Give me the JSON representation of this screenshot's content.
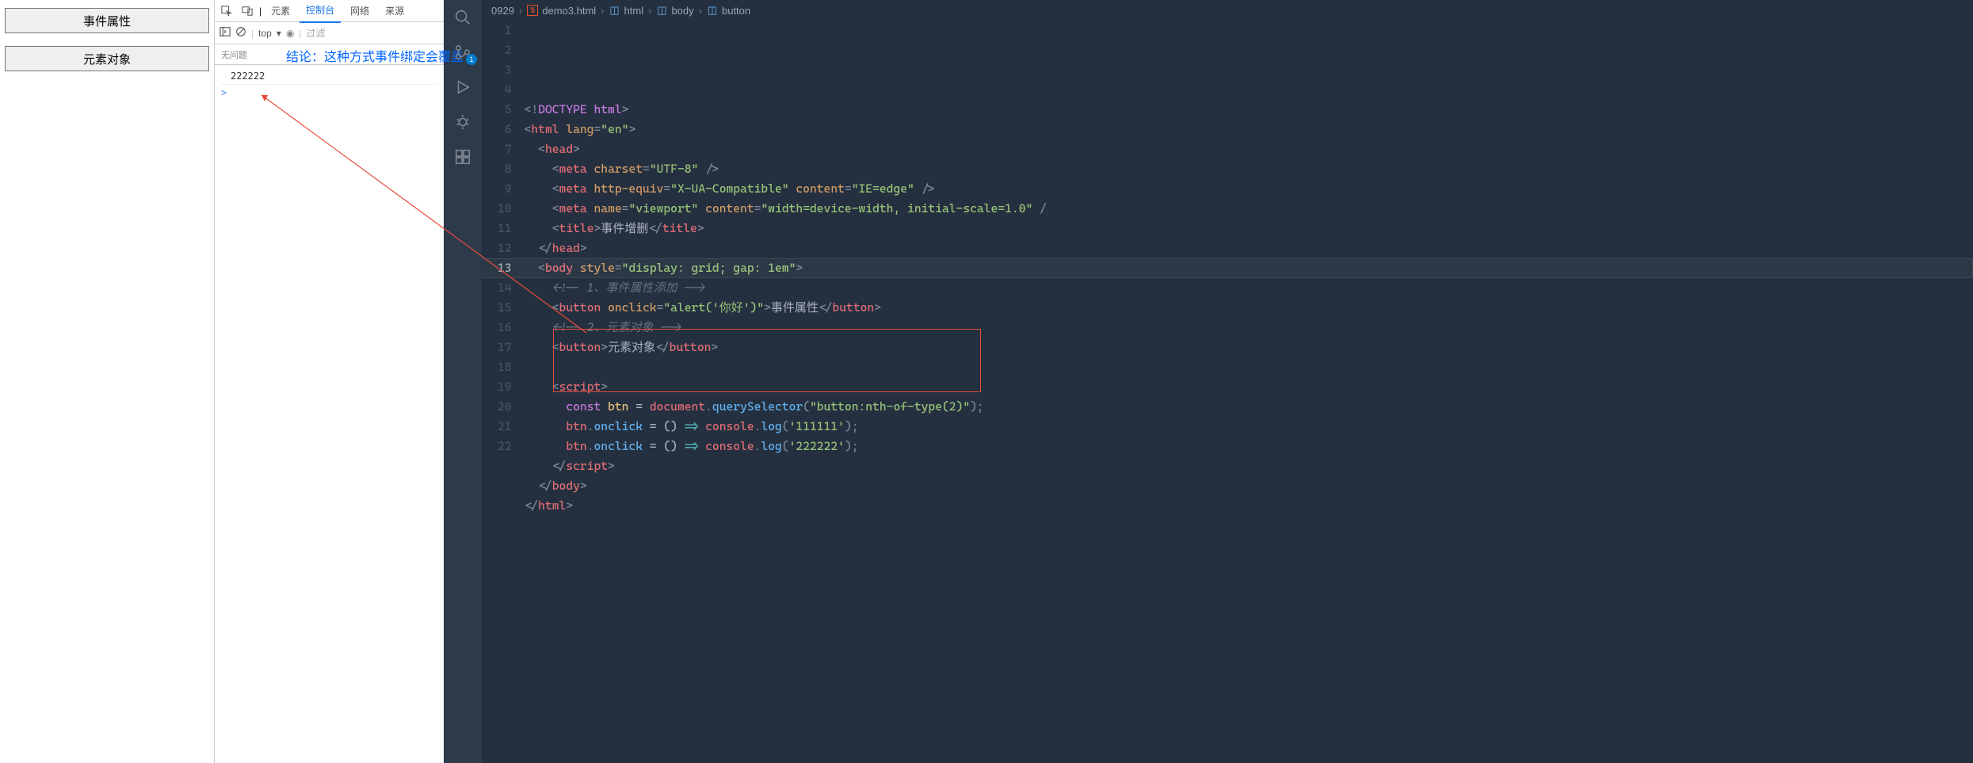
{
  "browser": {
    "buttons": [
      "事件属性",
      "元素对象"
    ]
  },
  "devtools": {
    "tabs": [
      "元素",
      "控制台",
      "网络",
      "来源"
    ],
    "active_tab_index": 1,
    "toolbar": {
      "top": "top",
      "filter": "过滤"
    },
    "filter_label": "无问题",
    "console_output": "222222",
    "prompt": ">"
  },
  "annotation": {
    "text": "结论：这种方式事件绑定会覆盖"
  },
  "vscode": {
    "badge_count": "1",
    "breadcrumb": {
      "items": [
        "0929",
        "demo3.html",
        "html",
        "body",
        "button"
      ]
    },
    "code": {
      "lines": [
        {
          "n": 1,
          "tokens": [
            [
              "<!",
              "punc"
            ],
            [
              "DOCTYPE html",
              "doctype"
            ],
            [
              ">",
              "punc"
            ]
          ]
        },
        {
          "n": 2,
          "tokens": [
            [
              "<",
              "punc"
            ],
            [
              "html",
              "tag"
            ],
            [
              " ",
              "text"
            ],
            [
              "lang",
              "attr"
            ],
            [
              "=",
              "punc"
            ],
            [
              "\"en\"",
              "str"
            ],
            [
              ">",
              "punc"
            ]
          ]
        },
        {
          "n": 3,
          "tokens": [
            [
              "  <",
              "punc"
            ],
            [
              "head",
              "tag"
            ],
            [
              ">",
              "punc"
            ]
          ]
        },
        {
          "n": 4,
          "tokens": [
            [
              "    <",
              "punc"
            ],
            [
              "meta",
              "tag"
            ],
            [
              " ",
              "text"
            ],
            [
              "charset",
              "attr"
            ],
            [
              "=",
              "punc"
            ],
            [
              "\"UTF-8\"",
              "str"
            ],
            [
              " />",
              "punc"
            ]
          ]
        },
        {
          "n": 5,
          "tokens": [
            [
              "    <",
              "punc"
            ],
            [
              "meta",
              "tag"
            ],
            [
              " ",
              "text"
            ],
            [
              "http-equiv",
              "attr"
            ],
            [
              "=",
              "punc"
            ],
            [
              "\"X-UA-Compatible\"",
              "str"
            ],
            [
              " ",
              "text"
            ],
            [
              "content",
              "attr"
            ],
            [
              "=",
              "punc"
            ],
            [
              "\"IE=edge\"",
              "str"
            ],
            [
              " />",
              "punc"
            ]
          ]
        },
        {
          "n": 6,
          "tokens": [
            [
              "    <",
              "punc"
            ],
            [
              "meta",
              "tag"
            ],
            [
              " ",
              "text"
            ],
            [
              "name",
              "attr"
            ],
            [
              "=",
              "punc"
            ],
            [
              "\"viewport\"",
              "str"
            ],
            [
              " ",
              "text"
            ],
            [
              "content",
              "attr"
            ],
            [
              "=",
              "punc"
            ],
            [
              "\"width=device-width, initial-scale=1.0\"",
              "str"
            ],
            [
              " /",
              "punc"
            ]
          ]
        },
        {
          "n": 7,
          "tokens": [
            [
              "    <",
              "punc"
            ],
            [
              "title",
              "tag"
            ],
            [
              ">",
              "punc"
            ],
            [
              "事件增删",
              "text"
            ],
            [
              "</",
              "punc"
            ],
            [
              "title",
              "tag"
            ],
            [
              ">",
              "punc"
            ]
          ]
        },
        {
          "n": 8,
          "tokens": [
            [
              "  </",
              "punc"
            ],
            [
              "head",
              "tag"
            ],
            [
              ">",
              "punc"
            ]
          ]
        },
        {
          "n": 9,
          "tokens": [
            [
              "  <",
              "punc"
            ],
            [
              "body",
              "tag"
            ],
            [
              " ",
              "text"
            ],
            [
              "style",
              "attr"
            ],
            [
              "=",
              "punc"
            ],
            [
              "\"display: grid; gap: 1em\"",
              "str"
            ],
            [
              ">",
              "punc"
            ]
          ]
        },
        {
          "n": 10,
          "tokens": [
            [
              "    ",
              "text"
            ],
            [
              "<!-- 1、事件属性添加 -->",
              "cm-cn"
            ]
          ]
        },
        {
          "n": 11,
          "tokens": [
            [
              "    <",
              "punc"
            ],
            [
              "button",
              "tag"
            ],
            [
              " ",
              "text"
            ],
            [
              "onclick",
              "attr"
            ],
            [
              "=",
              "punc"
            ],
            [
              "\"alert('你好')\"",
              "str"
            ],
            [
              ">",
              "punc"
            ],
            [
              "事件属性",
              "text"
            ],
            [
              "</",
              "punc"
            ],
            [
              "button",
              "tag"
            ],
            [
              ">",
              "punc"
            ]
          ]
        },
        {
          "n": 12,
          "tokens": [
            [
              "    ",
              "text"
            ],
            [
              "<!-- 2、元素对象 -->",
              "cm-cn"
            ]
          ]
        },
        {
          "n": 13,
          "tokens": [
            [
              "    <",
              "punc"
            ],
            [
              "button",
              "tag"
            ],
            [
              ">",
              "punc"
            ],
            [
              "元素对象",
              "text"
            ],
            [
              "</",
              "punc"
            ],
            [
              "button",
              "tag"
            ],
            [
              ">",
              "punc"
            ]
          ],
          "active": true
        },
        {
          "n": 14,
          "tokens": []
        },
        {
          "n": 15,
          "tokens": [
            [
              "    <",
              "punc"
            ],
            [
              "script",
              "tag"
            ],
            [
              ">",
              "punc"
            ]
          ]
        },
        {
          "n": 16,
          "tokens": [
            [
              "      ",
              "text"
            ],
            [
              "const",
              "kw"
            ],
            [
              " ",
              "text"
            ],
            [
              "btn",
              "const"
            ],
            [
              " = ",
              "text"
            ],
            [
              "document",
              "var"
            ],
            [
              ".",
              "punc"
            ],
            [
              "querySelector",
              "fn"
            ],
            [
              "(",
              "punc"
            ],
            [
              "\"button:nth-of-type(2)\"",
              "str"
            ],
            [
              ");",
              "punc"
            ]
          ]
        },
        {
          "n": 17,
          "tokens": [
            [
              "      ",
              "text"
            ],
            [
              "btn",
              "var"
            ],
            [
              ".",
              "punc"
            ],
            [
              "onclick",
              "fn"
            ],
            [
              " = () ",
              "text"
            ],
            [
              "=>",
              "op"
            ],
            [
              " ",
              "text"
            ],
            [
              "console",
              "var"
            ],
            [
              ".",
              "punc"
            ],
            [
              "log",
              "fn"
            ],
            [
              "(",
              "punc"
            ],
            [
              "'111111'",
              "str"
            ],
            [
              ");",
              "punc"
            ]
          ]
        },
        {
          "n": 18,
          "tokens": [
            [
              "      ",
              "text"
            ],
            [
              "btn",
              "var"
            ],
            [
              ".",
              "punc"
            ],
            [
              "onclick",
              "fn"
            ],
            [
              " = () ",
              "text"
            ],
            [
              "=>",
              "op"
            ],
            [
              " ",
              "text"
            ],
            [
              "console",
              "var"
            ],
            [
              ".",
              "punc"
            ],
            [
              "log",
              "fn"
            ],
            [
              "(",
              "punc"
            ],
            [
              "'222222'",
              "str"
            ],
            [
              ");",
              "punc"
            ]
          ]
        },
        {
          "n": 19,
          "tokens": [
            [
              "    </",
              "punc"
            ],
            [
              "script",
              "tag"
            ],
            [
              ">",
              "punc"
            ]
          ]
        },
        {
          "n": 20,
          "tokens": [
            [
              "  </",
              "punc"
            ],
            [
              "body",
              "tag"
            ],
            [
              ">",
              "punc"
            ]
          ]
        },
        {
          "n": 21,
          "tokens": [
            [
              "</",
              "punc"
            ],
            [
              "html",
              "tag"
            ],
            [
              ">",
              "punc"
            ]
          ]
        },
        {
          "n": 22,
          "tokens": []
        }
      ]
    }
  }
}
